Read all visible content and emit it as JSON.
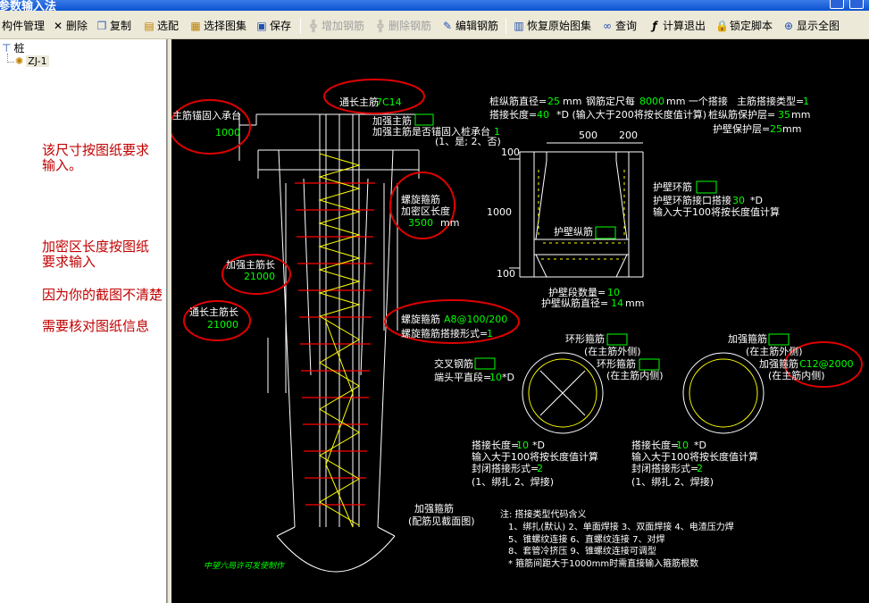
{
  "window": {
    "title": "参数输入法"
  },
  "toolbar": {
    "items": [
      {
        "label": "构件管理",
        "icon": "component-manage-icon",
        "enabled": true
      },
      {
        "label": "删除",
        "icon": "delete-icon",
        "enabled": true
      },
      {
        "label": "复制",
        "icon": "copy-icon",
        "enabled": true
      },
      {
        "label": "选配",
        "icon": "select-config-icon",
        "enabled": true
      },
      {
        "label": "选择图集",
        "icon": "atlas-icon",
        "enabled": true
      },
      {
        "label": "保存",
        "icon": "save-icon",
        "enabled": true
      },
      {
        "label": "增加钢筋",
        "icon": "add-rebar-icon",
        "enabled": false
      },
      {
        "label": "删除钢筋",
        "icon": "remove-rebar-icon",
        "enabled": false
      },
      {
        "label": "编辑钢筋",
        "icon": "edit-rebar-icon",
        "enabled": true
      },
      {
        "label": "恢复原始图集",
        "icon": "restore-atlas-icon",
        "enabled": true
      },
      {
        "label": "查询",
        "icon": "binoculars-icon",
        "enabled": true
      },
      {
        "label": "计算退出",
        "icon": "function-icon",
        "enabled": true
      },
      {
        "label": "锁定脚本",
        "icon": "lock-icon",
        "enabled": true
      },
      {
        "label": "显示全图",
        "icon": "zoom-all-icon",
        "enabled": true
      }
    ]
  },
  "tree": {
    "root": "桩",
    "child": "ZJ-1"
  },
  "notes": [
    "该尺寸按图纸要求",
    "输入。",
    "加密区长度按图纸",
    "要求输入",
    "因为你的截图不清楚",
    "需要核对图纸信息"
  ],
  "drawing": {
    "through_main_bar_title": "通长主筋",
    "through_main_bar_value": "7C14",
    "anchor_label": "主筋锚固入承台",
    "anchor_value": "1000",
    "add_main_bar": "加强主筋",
    "add_main_bar_anchor": "加强主筋是否锚固入桩承台",
    "add_main_bar_anchor_value": "1",
    "add_main_bar_anchor_opts": "(1、是; 2、否)",
    "spiral_dense_label1": "螺旋箍筋",
    "spiral_dense_label2": "加密区长度",
    "spiral_dense_value": "3500",
    "spiral_dense_unit": "mm",
    "add_main_len_label": "加强主筋长",
    "add_main_len_value": "21000",
    "through_main_len_label": "通长主筋长",
    "through_main_len_value": "21000",
    "spiral_stirrup_label": "螺旋箍筋",
    "spiral_stirrup_value": "A8@100/200",
    "spiral_lap_label": "螺旋箍筋搭接形式=",
    "spiral_lap_value": "1",
    "bottom_add_stirrup": "加强箍筋",
    "bottom_add_stirrup_note": "(配筋见截面图)",
    "credit": "中望六局许可发使制作",
    "p1": "桩纵筋直径=",
    "p1v": "25",
    "p1u": "mm",
    "p2": "钢筋定尺每",
    "p2v": "8000",
    "p2u": "mm 一个搭接",
    "p3": "主筋搭接类型=",
    "p3v": "1",
    "p4": "搭接长度=",
    "p4v": "40",
    "p4u": "*D (输入大于200将按长度值计算)",
    "p5": "桩纵筋保护层=",
    "p5v": "35",
    "p5u": "mm",
    "p6": "护壁保护层=",
    "p6v": "25",
    "p6u": "mm",
    "dim_500": "500",
    "dim_200": "200",
    "dim_100a": "100",
    "dim_1000": "1000",
    "dim_100b": "100",
    "wall_ring": "护壁环筋",
    "wall_ring_lap": "护壁环筋接口搭接",
    "wall_ring_lap_v": "30",
    "wall_ring_lap_u": "*D",
    "wall_ring_lap_note": "输入大于100将按长度值计算",
    "wall_long": "护壁纵筋",
    "wall_seg": "护壁段数量=",
    "wall_seg_v": "10",
    "wall_long_d": "护壁纵筋直径=",
    "wall_long_d_v": "14",
    "wall_long_d_u": "mm",
    "ring_stirrup": "环形箍筋",
    "ring_stirrup_out": "(在主筋外侧)",
    "ring_stirrup_in_label": "环形箍筋",
    "ring_stirrup_in": "(在主筋内侧)",
    "cross_bar": "交叉钢筋",
    "end_len": "端头平直段=",
    "end_len_v": "10",
    "end_len_u": "*D",
    "add_stirrup_r": "加强箍筋",
    "add_stirrup_r_out": "(在主筋外侧)",
    "add_stirrup_r2": "加强箍筋",
    "add_stirrup_r2_v": "C12@2000",
    "add_stirrup_r2_in": "(在主筋内侧)",
    "lap_len_l": "搭接长度=",
    "lap_len_l_v": "10",
    "lap_len_l_u": "*D",
    "lap_len_l_note": "输入大于100将按长度值计算",
    "close_l": "封闭搭接形式=",
    "close_l_v": "2",
    "close_l_opts": "(1、绑扎  2、焊接)",
    "lap_len_r": "搭接长度=",
    "lap_len_r_v": "10",
    "lap_len_r_u": "*D",
    "lap_len_r_note": "输入大于100将按长度值计算",
    "close_r": "封闭搭接形式=",
    "close_r_v": "2",
    "close_r_opts": "(1、绑扎  2、焊接)",
    "legend_title": "注: 搭接类型代码含义",
    "legend_1": "1、绑扎(默认)    2、单面焊接    3、双面焊接    4、电渣压力焊",
    "legend_2": "5、锥螺纹连接    6、直螺纹连接    7、对焊",
    "legend_3": "8、套管冷挤压    9、锥螺纹连接可调型",
    "legend_4": "* 箍筋间距大于1000mm时需直接输入箍筋根数"
  },
  "colors": {
    "canvas": "#000000",
    "annotation": "#c00000",
    "cad_value": "#00ff00",
    "rebar_red": "#ff0000",
    "rebar_yellow": "#ffff00"
  }
}
